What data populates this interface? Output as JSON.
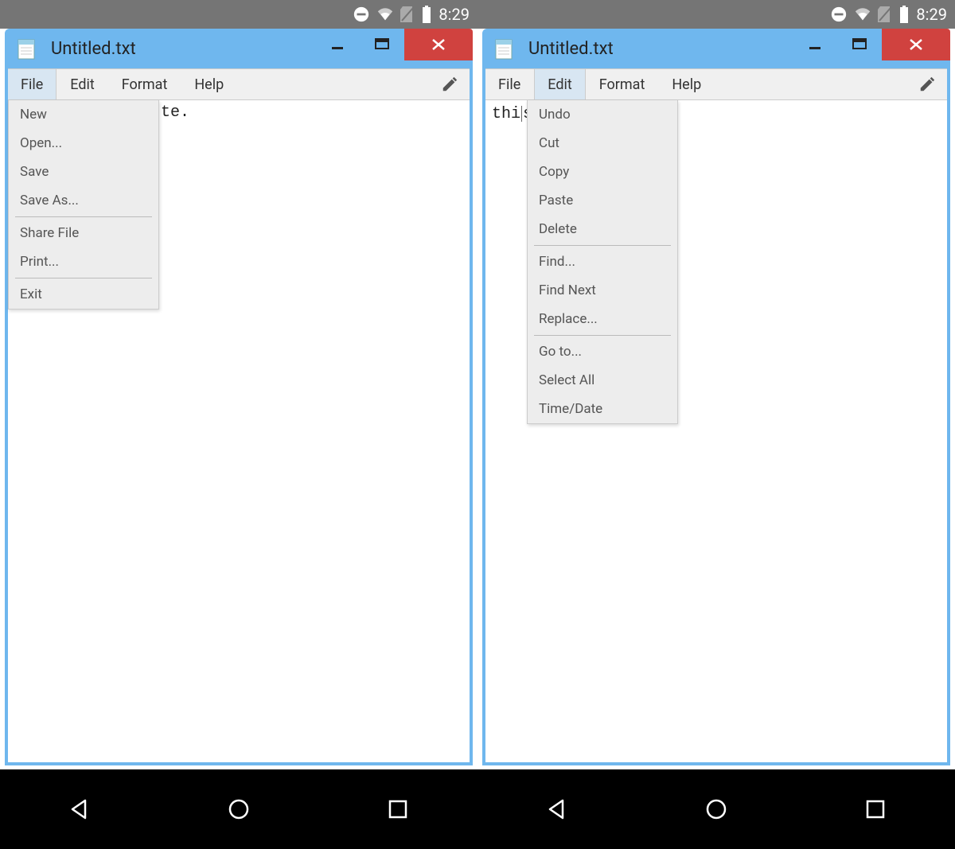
{
  "status": {
    "time": "8:29"
  },
  "left": {
    "title": "Untitled.txt",
    "menubar": [
      "File",
      "Edit",
      "Format",
      "Help"
    ],
    "active_menu_index": 0,
    "editor_visible_fragment": "te.",
    "dropdown": {
      "groups": [
        [
          "New",
          "Open...",
          "Save",
          "Save As..."
        ],
        [
          "Share File",
          "Print..."
        ],
        [
          "Exit"
        ]
      ]
    }
  },
  "right": {
    "title": "Untitled.txt",
    "menubar": [
      "File",
      "Edit",
      "Format",
      "Help"
    ],
    "active_menu_index": 1,
    "editor_text_before_caret": "thi",
    "editor_text_after_caret": "s",
    "dropdown": {
      "groups": [
        [
          "Undo",
          "Cut",
          "Copy",
          "Paste",
          "Delete"
        ],
        [
          "Find...",
          "Find Next",
          "Replace..."
        ],
        [
          "Go to...",
          "Select All",
          "Time/Date"
        ]
      ]
    }
  }
}
